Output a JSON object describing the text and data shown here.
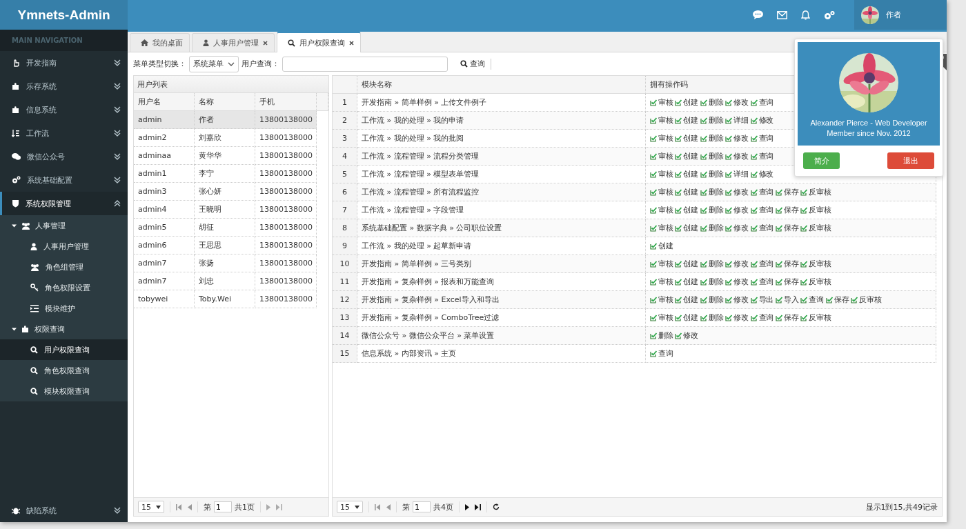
{
  "brand": "Ymnets-Admin",
  "sidebar": {
    "heading": "MAIN NAVIGATION",
    "items": [
      {
        "label": "开发指南",
        "expanded": false
      },
      {
        "label": "乐存系统",
        "expanded": false
      },
      {
        "label": "信息系统",
        "expanded": false
      },
      {
        "label": "工作流",
        "expanded": false
      },
      {
        "label": "微信公众号",
        "expanded": false
      },
      {
        "label": "系统基础配置",
        "expanded": false
      },
      {
        "label": "系统权限管理",
        "expanded": true,
        "children": [
          {
            "label": "人事管理",
            "expanded": true,
            "children": [
              {
                "label": "人事用户管理",
                "selected": false
              },
              {
                "label": "角色组管理",
                "selected": false
              },
              {
                "label": "角色权限设置",
                "selected": false
              },
              {
                "label": "模块维护",
                "selected": false
              }
            ]
          },
          {
            "label": "权限查询",
            "expanded": true,
            "children": [
              {
                "label": "用户权限查询",
                "selected": true
              },
              {
                "label": "角色权限查询",
                "selected": false
              },
              {
                "label": "模块权限查询",
                "selected": false
              }
            ]
          }
        ]
      }
    ],
    "bottom_item": {
      "label": "缺陷系统",
      "expanded": false
    }
  },
  "header": {
    "user_name": "作者"
  },
  "user_popup": {
    "line_1": "Alexander Pierce - Web Developer",
    "line_2": "Member since Nov. 2012",
    "buttons": [
      "简介",
      "退出"
    ]
  },
  "tabs": [
    {
      "label": "我的桌面",
      "selected": false,
      "closable": false
    },
    {
      "label": "人事用户管理",
      "selected": false,
      "closable": true
    },
    {
      "label": "用户权限查询",
      "selected": true,
      "closable": true
    }
  ],
  "toolbar": {
    "menu_type_label": "菜单类型切换：",
    "menu_type_value": "系统菜单",
    "user_query_label": "用户查询：",
    "query_button": "查询"
  },
  "user_list": {
    "title": "用户列表",
    "columns": [
      "用户名",
      "名称",
      "手机"
    ],
    "rows": [
      {
        "cells": [
          "admin",
          "作者",
          "13800138000"
        ],
        "selected": true
      },
      {
        "cells": [
          "admin2",
          "刘嘉欣",
          "13800138000"
        ],
        "selected": false
      },
      {
        "cells": [
          "adminaa",
          "黄华华",
          "13800138000"
        ],
        "selected": false
      },
      {
        "cells": [
          "admin1",
          "李宁",
          "13800138000"
        ],
        "selected": false
      },
      {
        "cells": [
          "admin3",
          "张心妍",
          "13800138000"
        ],
        "selected": false
      },
      {
        "cells": [
          "admin4",
          "王晓明",
          "13800138000"
        ],
        "selected": false
      },
      {
        "cells": [
          "admin5",
          "胡征",
          "13800138000"
        ],
        "selected": false
      },
      {
        "cells": [
          "admin6",
          "王思思",
          "13800138000"
        ],
        "selected": false
      },
      {
        "cells": [
          "admin7",
          "张扬",
          "13800138000"
        ],
        "selected": false
      },
      {
        "cells": [
          "admin7",
          "刘忠",
          "13800138000"
        ],
        "selected": false
      },
      {
        "cells": [
          "tobywei",
          "Toby.Wei",
          "13800138000"
        ],
        "selected": false
      }
    ],
    "pager": {
      "page_size": "15",
      "page_prefix": "第",
      "page": "1",
      "page_total": "共1页",
      "next_enabled": false
    }
  },
  "module_list": {
    "columns": [
      "模块名称",
      "拥有操作码"
    ],
    "rows": [
      {
        "number": "1",
        "module": "开发指南 » 简单样例 » 上传文件例子",
        "codes": [
          "审核",
          "创建",
          "删除",
          "修改",
          "查询"
        ]
      },
      {
        "number": "2",
        "module": "工作流 » 我的处理 » 我的申请",
        "codes": [
          "审核",
          "创建",
          "删除",
          "详细",
          "修改"
        ]
      },
      {
        "number": "3",
        "module": "工作流 » 我的处理 » 我的批阅",
        "codes": [
          "审核",
          "创建",
          "删除",
          "修改",
          "查询"
        ]
      },
      {
        "number": "4",
        "module": "工作流 » 流程管理 » 流程分类管理",
        "codes": [
          "审核",
          "创建",
          "删除",
          "修改",
          "查询"
        ]
      },
      {
        "number": "5",
        "module": "工作流 » 流程管理 » 模型表单管理",
        "codes": [
          "审核",
          "创建",
          "删除",
          "详细",
          "修改"
        ]
      },
      {
        "number": "6",
        "module": "工作流 » 流程管理 » 所有流程监控",
        "codes": [
          "审核",
          "创建",
          "删除",
          "修改",
          "查询",
          "保存",
          "反审核"
        ]
      },
      {
        "number": "7",
        "module": "工作流 » 流程管理 » 字段管理",
        "codes": [
          "审核",
          "创建",
          "删除",
          "修改",
          "查询",
          "保存",
          "反审核"
        ]
      },
      {
        "number": "8",
        "module": "系统基础配置 » 数据字典 » 公司职位设置",
        "codes": [
          "审核",
          "创建",
          "删除",
          "修改",
          "查询",
          "保存",
          "反审核"
        ]
      },
      {
        "number": "9",
        "module": "工作流 » 我的处理 » 起草新申请",
        "codes": [
          "创建"
        ]
      },
      {
        "number": "10",
        "module": "开发指南 » 简单样例 » 三号类别",
        "codes": [
          "审核",
          "创建",
          "删除",
          "修改",
          "查询",
          "保存",
          "反审核"
        ]
      },
      {
        "number": "11",
        "module": "开发指南 » 复杂样例 » 报表和万能查询",
        "codes": [
          "审核",
          "创建",
          "删除",
          "修改",
          "查询",
          "保存",
          "反审核"
        ]
      },
      {
        "number": "12",
        "module": "开发指南 » 复杂样例 » Excel导入和导出",
        "codes": [
          "审核",
          "创建",
          "删除",
          "修改",
          "导出",
          "导入",
          "查询",
          "保存",
          "反审核"
        ]
      },
      {
        "number": "13",
        "module": "开发指南 » 复杂样例 » ComboTree过滤",
        "codes": [
          "审核",
          "创建",
          "删除",
          "修改",
          "查询",
          "保存",
          "反审核"
        ]
      },
      {
        "number": "14",
        "module": "微信公众号 » 微信公众平台 » 菜单设置",
        "codes": [
          "删除",
          "修改"
        ]
      },
      {
        "number": "15",
        "module": "信息系统 » 内部资讯 » 主页",
        "codes": [
          "查询"
        ]
      }
    ],
    "pager": {
      "page_size": "15",
      "page_prefix": "第",
      "page": "1",
      "page_total": "共4页",
      "next_enabled": true,
      "summary": "显示1到15,共49记录"
    }
  }
}
